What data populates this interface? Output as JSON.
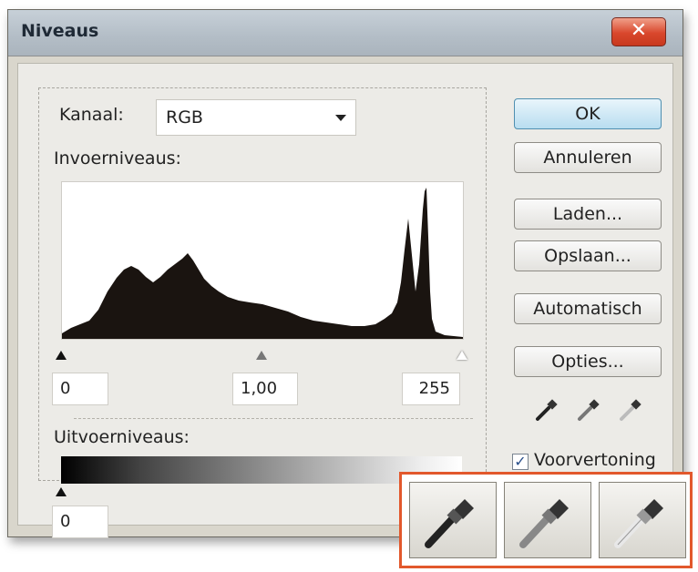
{
  "window": {
    "title": "Niveaus",
    "close_glyph": "✕"
  },
  "channel": {
    "label": "Kanaal:",
    "value": "RGB"
  },
  "input_levels": {
    "label": "Invoerniveaus:",
    "black": "0",
    "gamma": "1,00",
    "white": "255"
  },
  "output_levels": {
    "label": "Uitvoerniveaus:",
    "black": "0",
    "white": ""
  },
  "buttons": {
    "ok": "OK",
    "cancel": "Annuleren",
    "load": "Laden...",
    "save": "Opslaan...",
    "auto": "Automatisch",
    "options": "Opties..."
  },
  "preview": {
    "label": "Voorvertoning",
    "checked": true,
    "check_glyph": "✓"
  },
  "eyedroppers": [
    "black-point-eyedropper-icon",
    "gray-point-eyedropper-icon",
    "white-point-eyedropper-icon"
  ],
  "colors": {
    "accent_border": "#e2582c",
    "ok_blue": "#b8ddf0"
  }
}
